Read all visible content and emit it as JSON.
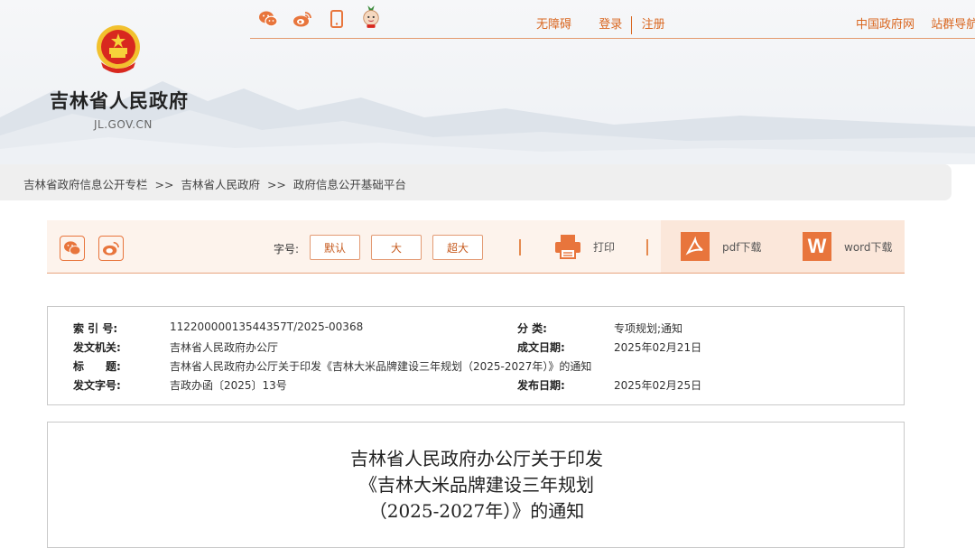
{
  "header": {
    "site_title": "吉林省人民政府",
    "site_domain": "JL.GOV.CN",
    "social_icons": [
      "wechat-icon",
      "weibo-icon",
      "mobile-icon",
      "mascot-icon"
    ],
    "accessibility": "无障碍",
    "login": "登录",
    "register": "注册",
    "gov_portal": "中国政府网",
    "site_nav": "站群导航"
  },
  "breadcrumb": {
    "items": [
      "吉林省政府信息公开专栏",
      "吉林省人民政府",
      "政府信息公开基础平台"
    ],
    "separator": ">>"
  },
  "toolbar": {
    "share_icons": [
      "wechat-icon",
      "weibo-icon"
    ],
    "font_label": "字号:",
    "font_default": "默认",
    "font_large": "大",
    "font_xlarge": "超大",
    "print": "打印",
    "pdf": "pdf下载",
    "word": "word下载"
  },
  "meta": {
    "index_label": "索 引 号:",
    "index_value": "11220000013544357T/2025-00368",
    "category_label": "分 类:",
    "category_value": "专项规划;通知",
    "issuer_label": "发文机关:",
    "issuer_value": "吉林省人民政府办公厅",
    "date_written_label": "成文日期:",
    "date_written_value": "2025年02月21日",
    "title_label": "标　　题:",
    "title_value": "吉林省人民政府办公厅关于印发《吉林大米品牌建设三年规划（2025-2027年）》的通知",
    "doc_no_label": "发文字号:",
    "doc_no_value": "吉政办函〔2025〕13号",
    "publish_label": "发布日期:",
    "publish_value": "2025年02月25日"
  },
  "document": {
    "title_line1": "吉林省人民政府办公厅关于印发",
    "title_line2": "《吉林大米品牌建设三年规划",
    "title_line3": "（2025-2027年）》的通知"
  },
  "colors": {
    "accent": "#d9661f",
    "toolbar_bg": "#fdf3ec",
    "download_bg": "#fbe7da",
    "breadcrumb_bg": "#efefef"
  }
}
